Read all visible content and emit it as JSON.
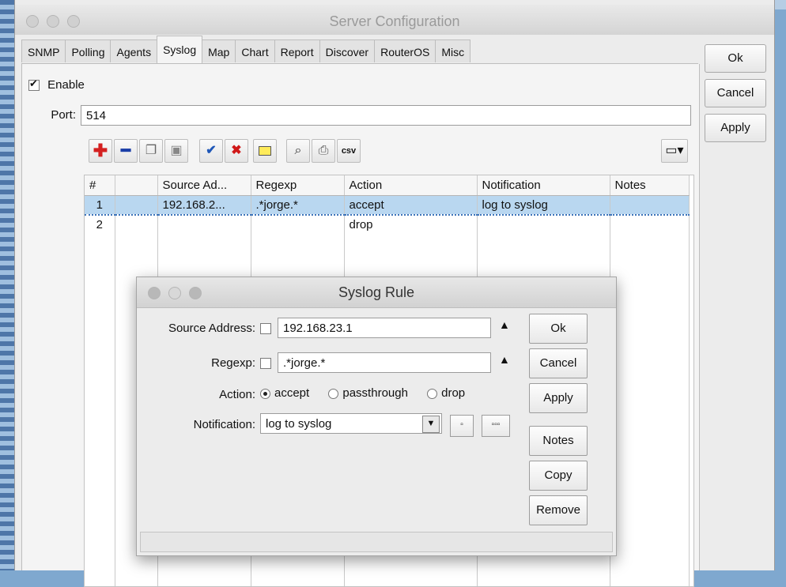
{
  "window": {
    "title": "Server Configuration"
  },
  "tabs": [
    "SNMP",
    "Polling",
    "Agents",
    "Syslog",
    "Map",
    "Chart",
    "Report",
    "Discover",
    "RouterOS",
    "Misc"
  ],
  "active_tab": "Syslog",
  "side_buttons": {
    "ok": "Ok",
    "cancel": "Cancel",
    "apply": "Apply"
  },
  "syslog": {
    "enable_label": "Enable",
    "enable_checked": true,
    "port_label": "Port:",
    "port_value": "514"
  },
  "toolbar": {
    "icons": [
      "add-icon",
      "remove-icon",
      "copy-icon",
      "paste-icon",
      "enable-check-icon",
      "disable-x-icon",
      "comment-icon",
      "find-binoculars-icon",
      "print-icon",
      "csv-export-icon",
      "columns-menu-icon"
    ],
    "csv_label": "csv"
  },
  "table": {
    "columns": [
      "#",
      "",
      "Source Ad...",
      "Regexp",
      "Action",
      "Notification",
      "Notes"
    ],
    "rows": [
      [
        "1",
        "",
        "192.168.2...",
        ".*jorge.*",
        "accept",
        "log to syslog",
        ""
      ],
      [
        "2",
        "",
        "",
        "",
        "drop",
        "",
        ""
      ]
    ]
  },
  "dialog": {
    "title": "Syslog Rule",
    "source_address_label": "Source Address:",
    "source_address_value": "192.168.23.1",
    "regexp_label": "Regexp:",
    "regexp_value": ".*jorge.*",
    "action_label": "Action:",
    "action_options": [
      "accept",
      "passthrough",
      "drop"
    ],
    "action_selected": "accept",
    "notification_label": "Notification:",
    "notification_value": "log to syslog",
    "buttons": {
      "ok": "Ok",
      "cancel": "Cancel",
      "apply": "Apply",
      "notes": "Notes",
      "copy": "Copy",
      "remove": "Remove"
    }
  }
}
